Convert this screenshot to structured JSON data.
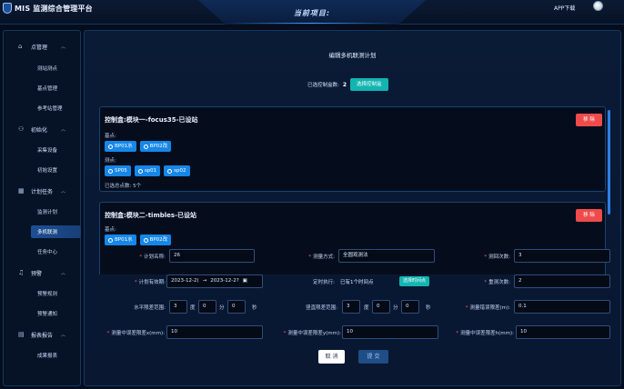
{
  "header": {
    "app_title": "MIS 监测综合管理平台",
    "center_title": "当前项目:",
    "app_download": "APP下载"
  },
  "sidebar": {
    "groups": [
      {
        "label": "点管理",
        "icon": "home-icon",
        "items": [
          "测站测点",
          "基点管理",
          "参考站管理"
        ]
      },
      {
        "label": "初始化",
        "icon": "user-icon",
        "items": [
          "采集设备",
          "初始设置"
        ]
      },
      {
        "label": "计划任务",
        "icon": "calendar-icon",
        "items": [
          "监测计划",
          "多机联测",
          "任务中心"
        ]
      },
      {
        "label": "预警",
        "icon": "bell-icon",
        "items": [
          "预警规则",
          "预警通知"
        ]
      },
      {
        "label": "报表报告",
        "icon": "document-icon",
        "items": [
          "成果报表"
        ]
      }
    ],
    "active_item": "多机联测"
  },
  "main": {
    "title": "编辑多机联测计划",
    "selected_label": "已选控制盒数:",
    "selected_count": "2",
    "select_button": "选择控制盒",
    "cards": [
      {
        "title": "控制盒:模块一-focus35-已设站",
        "remove": "移 除",
        "base_label": "基点:",
        "base_points": [
          "BP01水",
          "BP02改"
        ],
        "measure_label": "测点:",
        "measure_points": [
          "SP05",
          "sp01",
          "sp02"
        ],
        "count_label": "已选总点数: 5个"
      },
      {
        "title": "控制盒:模块二-timbles-已设站",
        "remove": "移 除",
        "base_label": "基点:",
        "base_points": [
          "BP01水",
          "BP02改"
        ]
      }
    ]
  },
  "form": {
    "plan_name_label": "计划名称:",
    "plan_name_value": "26",
    "measure_mode_label": "测量方式:",
    "measure_mode_value": "全圆观测法",
    "rounds_label": "测回次数:",
    "rounds_value": "3",
    "valid_period_label": "计划有效期:",
    "date_start": "2023-12-2(",
    "date_sep": "→",
    "date_end": "2023-12-2?",
    "timed_exec_label": "定时执行:",
    "timed_exec_value": "已有1个时间点",
    "timed_exec_button": "选择时间点",
    "retry_label": "重测次数:",
    "retry_value": "2",
    "horizontal_label": "水平限差范围:",
    "h_deg": "3",
    "h_min": "0",
    "h_sec": "0",
    "vertical_label": "竖直限差范围:",
    "v_deg": "3",
    "v_min": "0",
    "v_sec": "0",
    "distance_label": "测量错误限差(m):",
    "distance_value": "0.1",
    "unit_deg": "度",
    "unit_min": "分",
    "unit_sec": "秒",
    "err_x_label": "测量中误差限差x(mm):",
    "err_x_value": "10",
    "err_y_label": "测量中误差限差y(mm):",
    "err_y_value": "10",
    "err_h_label": "测量中误差限差h(mm):",
    "err_h_value": "10",
    "required_mark": "*"
  },
  "actions": {
    "cancel": "取 消",
    "submit": "提 交"
  },
  "colors": {
    "accent_blue": "#1687e8",
    "teal": "#12b5b0",
    "danger": "#ef4b4b",
    "background": "#050d1c"
  }
}
